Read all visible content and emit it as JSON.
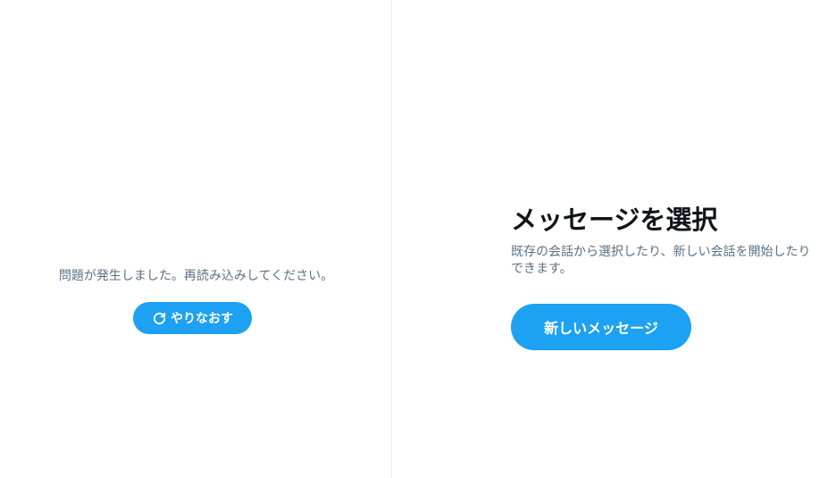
{
  "colors": {
    "accent": "#1da1f2",
    "secondary_text": "#5b7083",
    "primary_text": "#0f1419",
    "divider": "#ebeef0"
  },
  "error_panel": {
    "message": "問題が発生しました。再読み込みしてください。",
    "retry_label": "やりなおす",
    "retry_icon": "refresh-icon"
  },
  "conversation_panel": {
    "title": "メッセージを選択",
    "subtitle": "既存の会話から選択したり、新しい会話を開始したりできます。",
    "new_message_label": "新しいメッセージ"
  }
}
